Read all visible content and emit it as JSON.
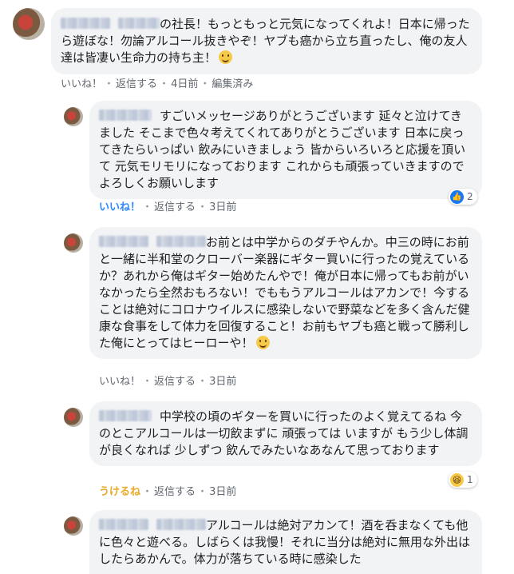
{
  "comments": [
    {
      "text": "の社長！もっともっと元気になってくれよ！日本に帰ったら遊ぼな！勿論アルコール抜きやぞ！ヤブも癌から立ち直ったし、俺の友人達は皆凄い生命力の持ち主！",
      "emoji": "smiling-wink",
      "actions": {
        "like": "いいね！",
        "reply": "返信する",
        "time": "4日前",
        "edited": "編集済み"
      }
    },
    {
      "text": "すごいメッセージありがとうございます 延々と泣けてきました そこまで色々考えてくれてありがとうございます 日本に戻ってきたらいっぱい 飲みにいきましょう 皆からいろいろと応援を頂いて 元気モリモリになっております これからも頑張っていきますので よろしくお願いします",
      "actions": {
        "like": "いいね！",
        "reply": "返信する",
        "time": "3日前"
      },
      "reaction": {
        "type": "like",
        "count": "2"
      }
    },
    {
      "text": "お前とは中学からのダチやんか。中三の時にお前と一緒に半和堂のクローバー楽器にギター買いに行ったの覚えているか？あれから俺はギター始めたんやで！俺が日本に帰ってもお前がいなかったら全然おもろない！でももうアルコールはアカンで！今することは絶対にコロナウイルスに感染しないで野菜などを多く含んだ健康な食事をして体力を回復すること！お前もヤブも癌と戦って勝利した俺にとってはヒーローや！",
      "emoji": "smiling-wink",
      "actions": {
        "like": "いいね！",
        "reply": "返信する",
        "time": "3日前"
      }
    },
    {
      "text": "中学校の頃のギターを買いに行ったのよく覚えてるね 今のとこアルコールは一切飲まずに 頑張っては いますが もう少し体調が良くなれば 少しずつ 飲んでみたいなあなんて思っております",
      "actions": {
        "like": "うけるね",
        "reply": "返信する",
        "time": "3日前"
      },
      "reaction": {
        "type": "haha",
        "count": "1"
      }
    },
    {
      "text": "アルコールは絶対アカンて！酒を呑まなくても他に色々と遊べる。しばらくは我慢！それに当分は絶対に無用な外出はしたらあかんで。体力が落ちている時に感染した"
    }
  ]
}
